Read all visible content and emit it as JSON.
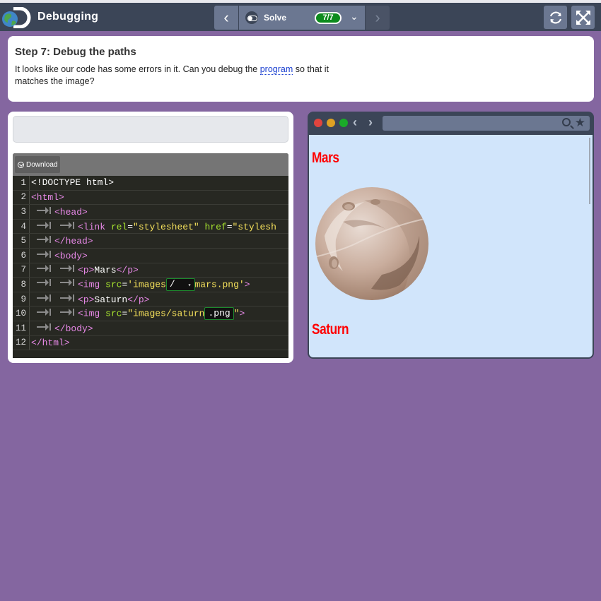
{
  "app": {
    "title": "Debugging"
  },
  "header": {
    "level_label": "Solve",
    "progress": "7/7"
  },
  "instructions": {
    "title": "Step 7: Debug the paths",
    "text_before": "It looks like our code has some errors in it. Can you debug the ",
    "link": "program",
    "text_after": " so that it matches the image?"
  },
  "editor": {
    "download_label": "Download",
    "lines": {
      "n1": "1",
      "n2": "2",
      "n3": "3",
      "n4": "4",
      "n5": "5",
      "n6": "6",
      "n7": "7",
      "n8": "8",
      "n9": "9",
      "n10": "10",
      "n11": "11",
      "n12": "12",
      "l1": "<!DOCTYPE html>",
      "l2": "<html>",
      "l3": "<head>",
      "l4_tag": "<link",
      "l4_attr1": " rel",
      "l4_val1": "\"stylesheet\"",
      "l4_attr2": " href",
      "l4_val2": "\"stylesh",
      "l5": "</head>",
      "l6": "<body>",
      "l7_open": "<p>",
      "l7_text": "Mars",
      "l7_close": "</p>",
      "l8_tag": "<img",
      "l8_attr": " src",
      "l8_val1": "'images",
      "l8_slot": "/",
      "l8_val2": "mars.png'",
      "l8_end": ">",
      "l9_open": "<p>",
      "l9_text": "Saturn",
      "l9_close": "</p>",
      "l10_tag": "<img",
      "l10_attr": " src",
      "l10_val1": "\"images/saturn",
      "l10_slot": ".png",
      "l10_val2": "\"",
      "l10_end": ">",
      "l11": "</body>",
      "l12": "</html>"
    }
  },
  "preview": {
    "caption1": "Mars",
    "caption2": "Saturn"
  },
  "colors": {
    "background": "#8466a0",
    "header": "#3b4557",
    "progress_green": "#0c8b1d",
    "caption_red": "#ff0000"
  }
}
